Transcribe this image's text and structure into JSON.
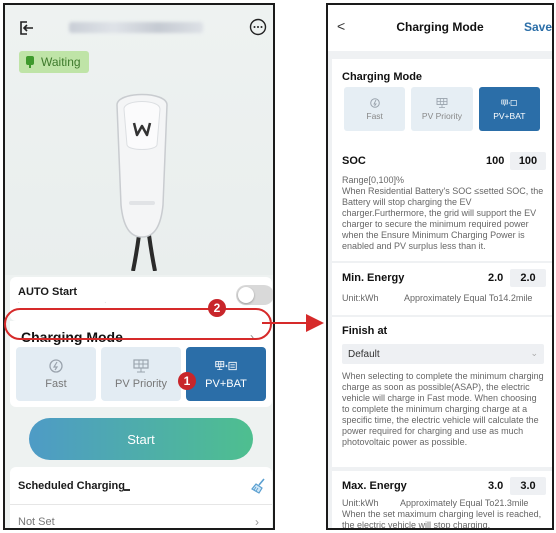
{
  "left": {
    "status": "Waiting",
    "auto_start": {
      "label": "AUTO Start",
      "enabled": false
    },
    "charging_mode": {
      "label": "Charging Mode",
      "options": [
        {
          "label": "Fast",
          "selected": false,
          "icon": "fast-charge-icon"
        },
        {
          "label": "PV Priority",
          "selected": false,
          "icon": "solar-panel-icon"
        },
        {
          "label": "PV+BAT",
          "selected": true,
          "icon": "solar-battery-icon"
        }
      ]
    },
    "start_button": "Start",
    "scheduled": {
      "label": "Scheduled Charging",
      "value": "Not Set"
    },
    "badges": {
      "one": "1",
      "two": "2"
    },
    "accent_color": "#2b6ea8",
    "highlight_color": "#d62a2a"
  },
  "right": {
    "nav": {
      "back": "<",
      "title": "Charging Mode",
      "save": "Save"
    },
    "mode": {
      "heading": "Charging Mode",
      "options": [
        {
          "label": "Fast",
          "selected": false
        },
        {
          "label": "PV Priority",
          "selected": false
        },
        {
          "label": "PV+BAT",
          "selected": true
        }
      ]
    },
    "soc": {
      "heading": "SOC",
      "value_plain": "100",
      "value_box": "100",
      "range": "Range[0,100]%",
      "desc": "When Residential Battery's SOC ≤setted SOC, the Battery will stop charging the EV charger.Furthermore, the grid will support the EV charger to secure the minimum required power when the Ensure Minimum Charging Power is enabled and PV surplus less than it."
    },
    "min_energy": {
      "heading": "Min. Energy",
      "value_plain": "2.0",
      "value_box": "2.0",
      "unit": "Unit:kWh",
      "approx": "Approximately Equal To14.2mile"
    },
    "finish_at": {
      "heading": "Finish at",
      "selected": "Default",
      "desc": "When selecting to complete the minimum charging charge as soon as possible(ASAP), the electric vehicle will charge in Fast mode. When choosing to complete the minimum charging charge at a specific time, the electric vehicle will calculate the power required for charging and use as much photovoltaic power as possible."
    },
    "max_energy": {
      "heading": "Max. Energy",
      "value_plain": "3.0",
      "value_box": "3.0",
      "unit": "Unit:kWh",
      "approx": "Approximately Equal To21.3mile",
      "desc": "When the set maximum charging level is reached, the electric vehicle will stop charging."
    }
  }
}
